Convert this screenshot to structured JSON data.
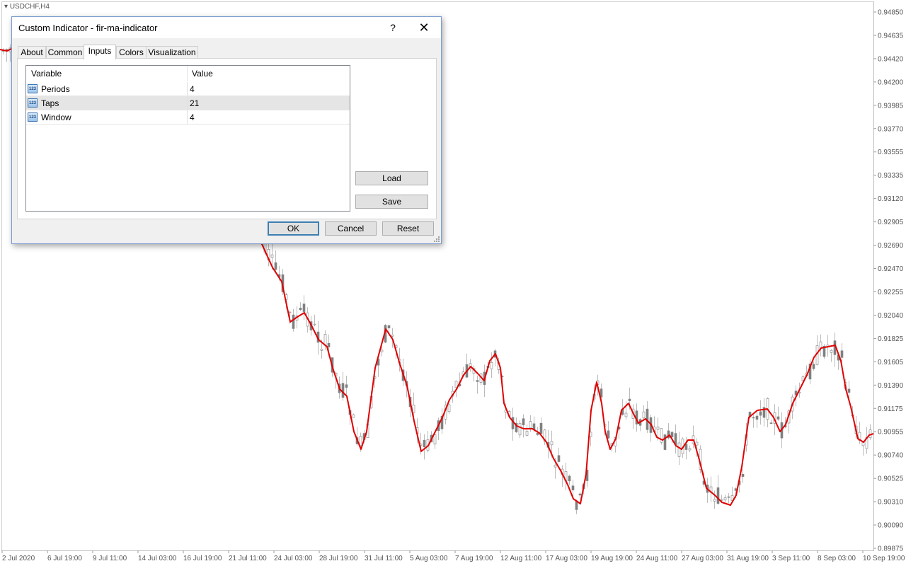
{
  "chart": {
    "symbol": "USDCHF,H4",
    "price_labels": [
      "0.94850",
      "0.94635",
      "0.94420",
      "0.94200",
      "0.93985",
      "0.93770",
      "0.93555",
      "0.93335",
      "0.93120",
      "0.92905",
      "0.92690",
      "0.92470",
      "0.92255",
      "0.92040",
      "0.91825",
      "0.91605",
      "0.91390",
      "0.91175",
      "0.90955",
      "0.90740",
      "0.90525",
      "0.90310",
      "0.90090",
      "0.89875"
    ],
    "date_labels": [
      "2 Jul 2020",
      "6 Jul 19:00",
      "9 Jul 11:00",
      "14 Jul 03:00",
      "16 Jul 19:00",
      "21 Jul 11:00",
      "24 Jul 03:00",
      "28 Jul 19:00",
      "31 Jul 11:00",
      "5 Aug 03:00",
      "7 Aug 19:00",
      "12 Aug 11:00",
      "17 Aug 03:00",
      "19 Aug 19:00",
      "24 Aug 11:00",
      "27 Aug 03:00",
      "31 Aug 19:00",
      "3 Sep 11:00",
      "8 Sep 03:00",
      "10 Sep 19:00"
    ],
    "ma_color": "#e00000",
    "candle_color": "#808080"
  },
  "dialog": {
    "title": "Custom Indicator - fir-ma-indicator",
    "help_label": "?",
    "close_label": "✕",
    "tabs": [
      {
        "label": "About",
        "active": false
      },
      {
        "label": "Common",
        "active": false
      },
      {
        "label": "Inputs",
        "active": true
      },
      {
        "label": "Colors",
        "active": false
      },
      {
        "label": "Visualization",
        "active": false
      }
    ],
    "grid": {
      "headers": [
        "Variable",
        "Value"
      ],
      "rows": [
        {
          "name": "Periods",
          "value": "4",
          "icon": "123-icon",
          "selected": false
        },
        {
          "name": "Taps",
          "value": "21",
          "icon": "123-icon",
          "selected": true
        },
        {
          "name": "Window",
          "value": "4",
          "icon": "123-icon",
          "selected": false
        }
      ]
    },
    "load_label": "Load",
    "save_label": "Save",
    "ok_label": "OK",
    "cancel_label": "Cancel",
    "reset_label": "Reset"
  }
}
